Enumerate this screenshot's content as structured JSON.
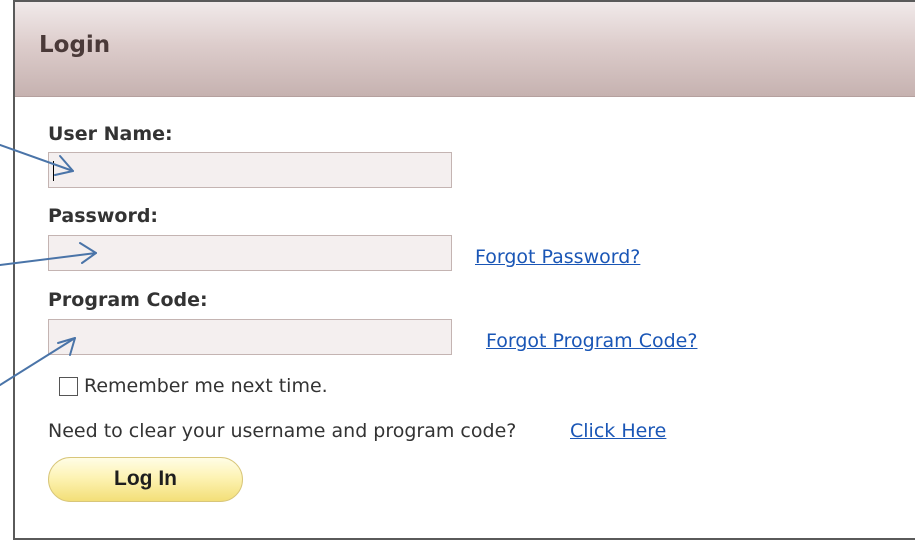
{
  "header": {
    "title": "Login"
  },
  "form": {
    "username": {
      "label": "User Name:",
      "value": ""
    },
    "password": {
      "label": "Password:",
      "value": "",
      "forgot_link": "Forgot Password?"
    },
    "program_code": {
      "label": "Program Code:",
      "value": "",
      "forgot_link": "Forgot Program Code?"
    },
    "remember": {
      "label": "Remember me next time.",
      "checked": false
    },
    "clear": {
      "text": "Need to clear your username and program code?",
      "link": "Click Here"
    },
    "submit_label": "Log In"
  },
  "colors": {
    "header_gradient_top": "#f1eaea",
    "header_gradient_bottom": "#c6b2b0",
    "link": "#1a56b6",
    "arrow": "#4a74a8",
    "button_gradient_top": "#fffde6",
    "button_gradient_bottom": "#f3df78"
  },
  "icons": {
    "annotation_arrows": "arrow-icon"
  }
}
